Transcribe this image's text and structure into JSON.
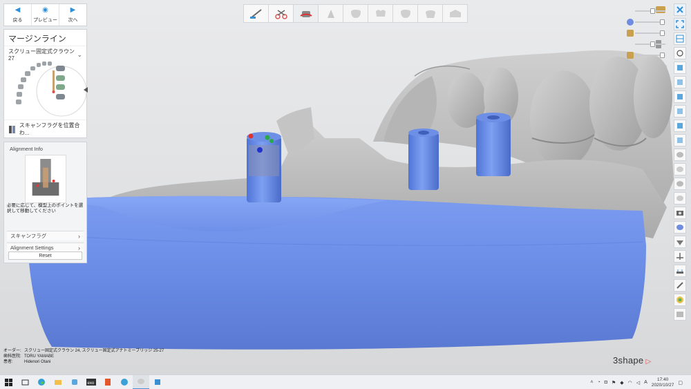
{
  "nav": {
    "back_label": "戻る",
    "preview_label": "プレビュー",
    "next_label": "次へ"
  },
  "margin": {
    "title": "マージンライン",
    "restoration": "スクリュー固定式クラウン 27",
    "scanflag_action": "スキャンフラグを位置合わ..."
  },
  "alignment": {
    "title": "Alignment Info",
    "help_text": "必要に応じて、模型上のポイントを選択して移動してください",
    "rows": [
      "スキャンフラグ",
      "Alignment Settings"
    ],
    "reset_label": "Reset"
  },
  "order": {
    "rows": [
      {
        "key": "オーダー:",
        "value": "スクリュー固定式クラウン 24, スクリュー固定式アナトミーブリッジ 25-27"
      },
      {
        "key": "歯科医院:",
        "value": "TORU YAMABE"
      },
      {
        "key": "患者:",
        "value": "Hidenori Otani"
      }
    ]
  },
  "brand": {
    "name": "3shape"
  },
  "clock": {
    "time": "17:40",
    "date": "2020/10/27"
  },
  "tray": {
    "ime": "A"
  },
  "colors": {
    "model_blue": "#6f93e8",
    "scan_gray": "#b9b9b9",
    "accent": "#2f8fd6",
    "brand_red": "#d9534f"
  }
}
